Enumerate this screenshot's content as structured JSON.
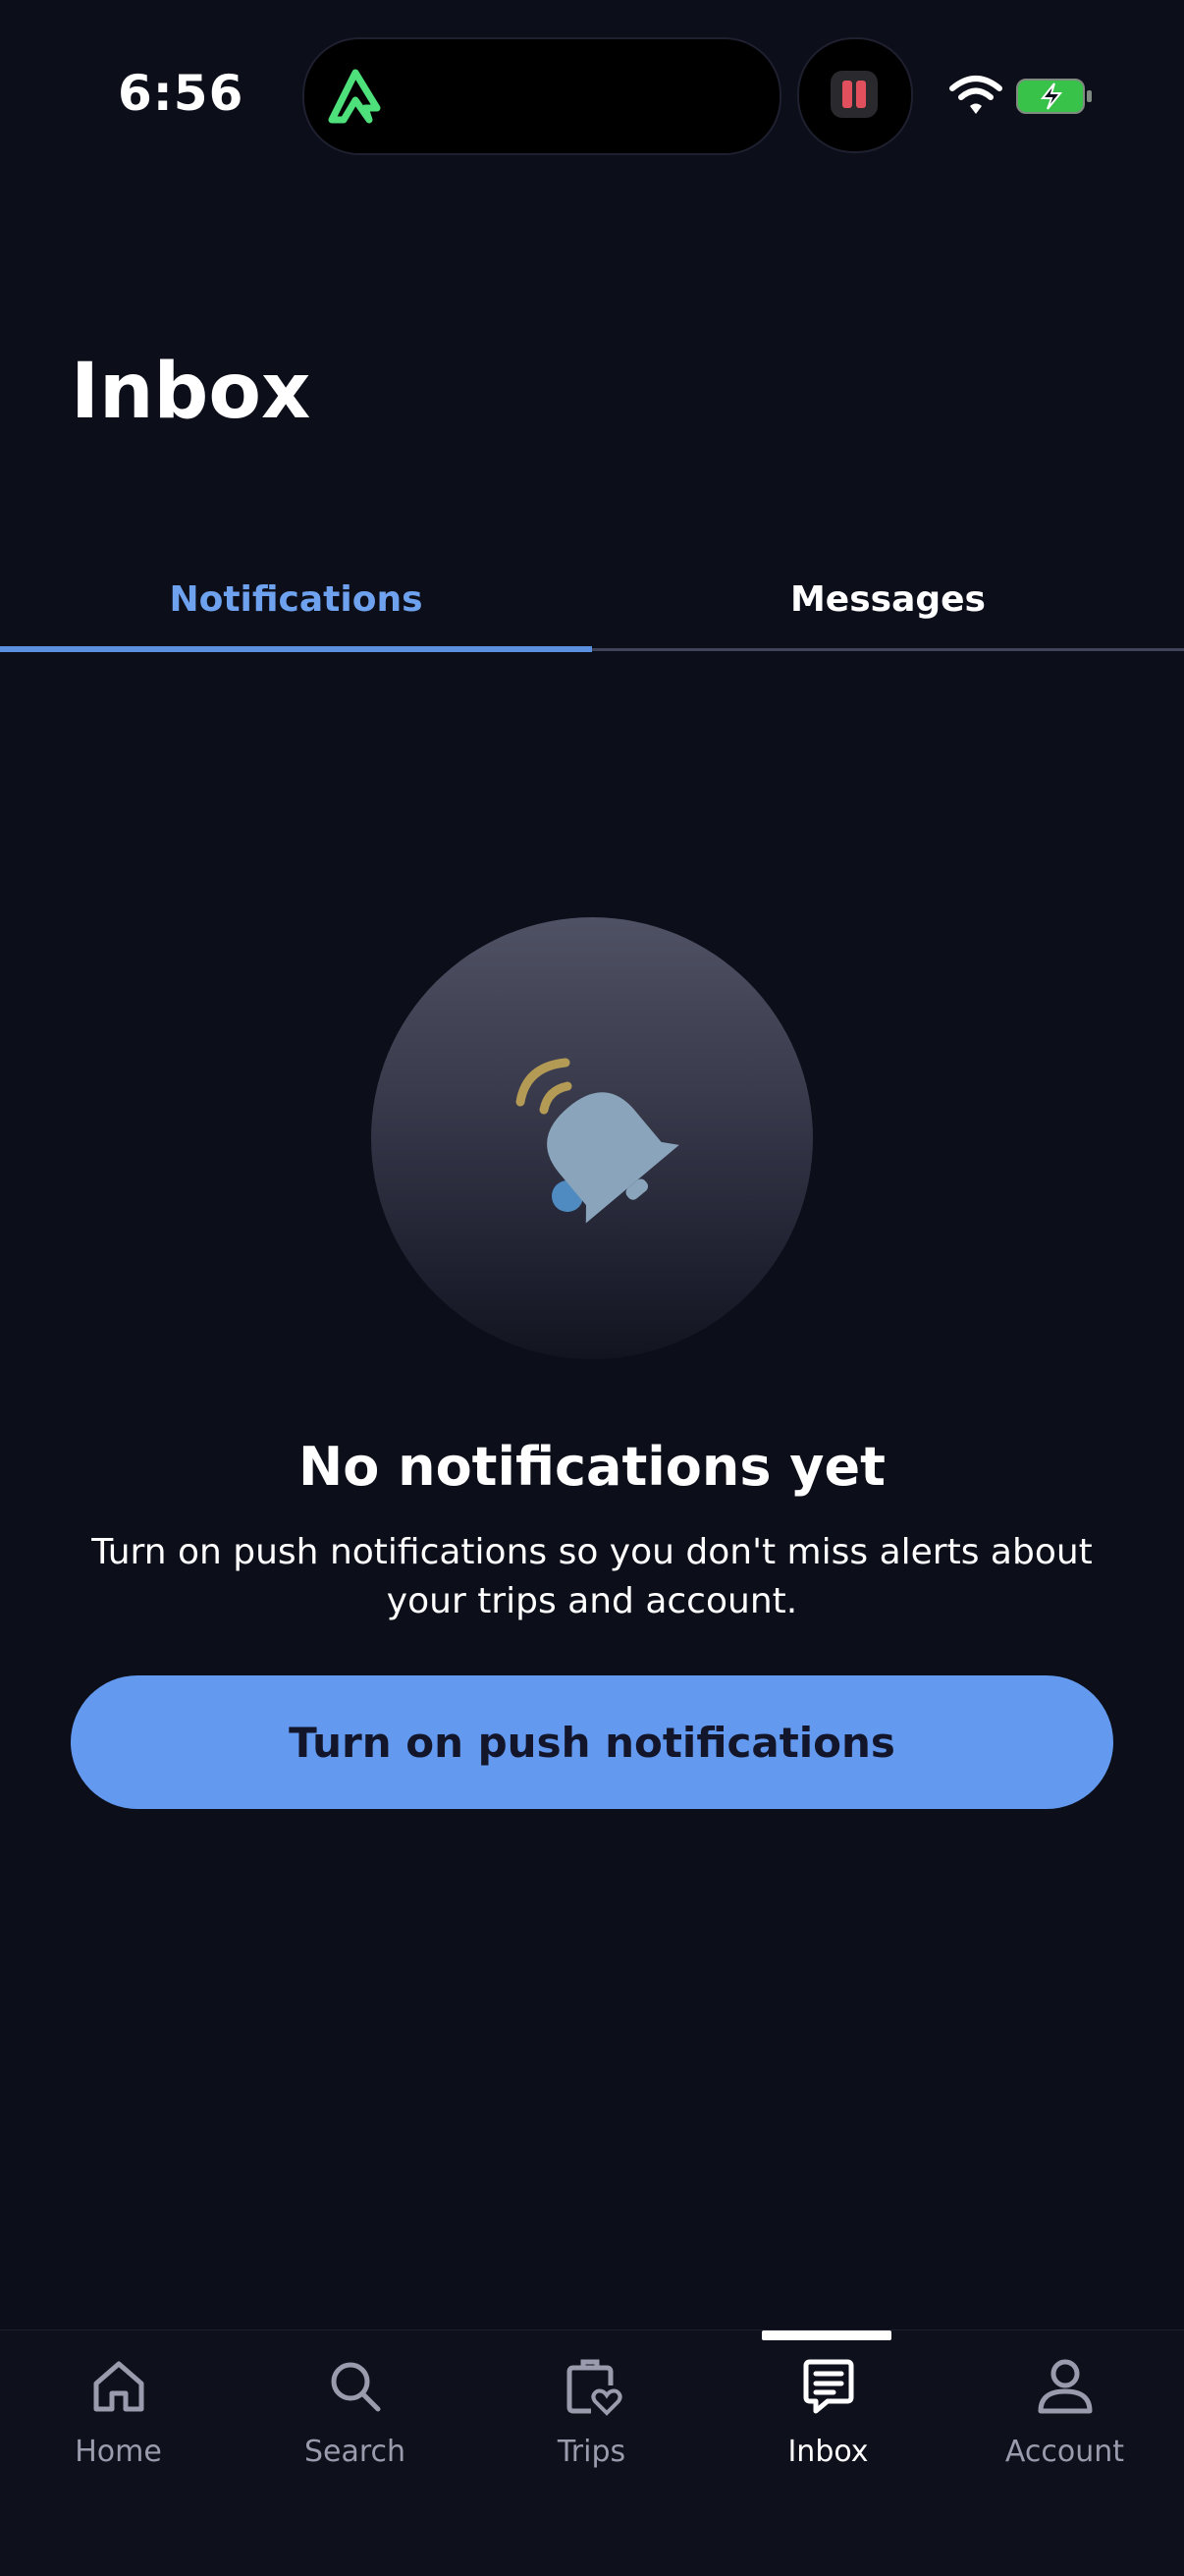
{
  "status_bar": {
    "time": "6:56"
  },
  "header": {
    "title": "Inbox"
  },
  "tabs": [
    {
      "label": "Notifications",
      "active": true
    },
    {
      "label": "Messages",
      "active": false
    }
  ],
  "empty_state": {
    "icon": "bell-icon",
    "title": "No notifications yet",
    "description": "Turn on push notifications so you don't miss alerts about your trips and account.",
    "button_label": "Turn on push notifications"
  },
  "bottom_nav": {
    "items": [
      {
        "label": "Home",
        "icon": "home-icon",
        "active": false
      },
      {
        "label": "Search",
        "icon": "search-icon",
        "active": false
      },
      {
        "label": "Trips",
        "icon": "trips-icon",
        "active": false
      },
      {
        "label": "Inbox",
        "icon": "inbox-icon",
        "active": true
      },
      {
        "label": "Account",
        "icon": "account-icon",
        "active": false
      }
    ]
  },
  "colors": {
    "background": "#0c0e1a",
    "accent": "#6399ee",
    "tab_active": "#6ea1ee"
  }
}
